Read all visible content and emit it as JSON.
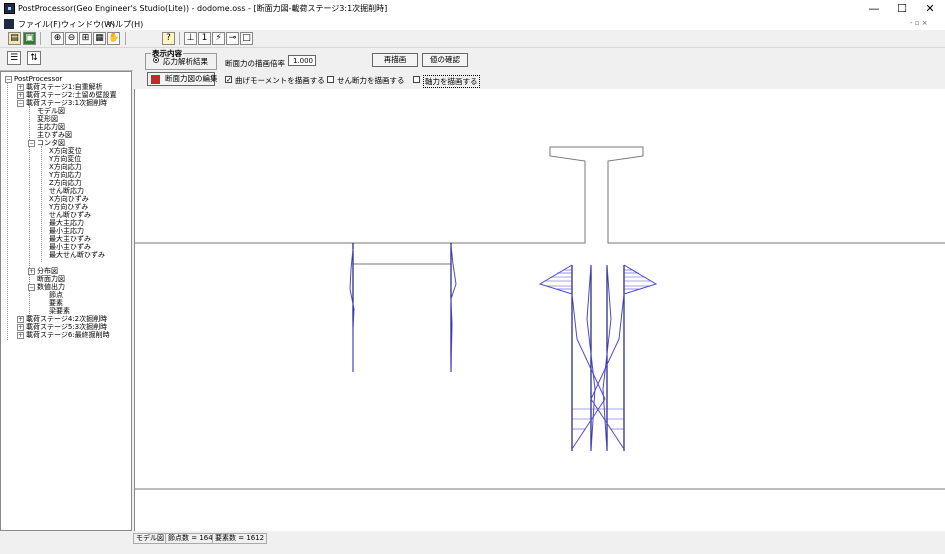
{
  "window": {
    "title": "PostProcessor(Geo Engineer's Studio(Lite)) - dodome.oss - [断面力図-載荷ステージ3:1次掘削時]",
    "minimize": "—",
    "maximize": "☐",
    "close": "✕"
  },
  "menu": {
    "items": [
      "ファイル(F)",
      "ウィンドウ(W)",
      "ヘルプ(H)"
    ],
    "mdi_controls": "- ▫ ×"
  },
  "left_tools": [
    "☰",
    "⇅"
  ],
  "tree": {
    "root": "PostProcessor",
    "nodes": [
      "載荷ステージ1:自重解析",
      "載荷ステージ2:土留め壁設置",
      "載荷ステージ3:1次掘削時",
      "モデル図",
      "変形図",
      "主応力図",
      "主ひずみ図",
      "コンタ図",
      "X方向変位",
      "Y方向変位",
      "X方向応力",
      "Y方向応力",
      "Z方向応力",
      "せん断応力",
      "X方向ひずみ",
      "Y方向ひずみ",
      "せん断ひずみ",
      "最大主応力",
      "最小主応力",
      "最大主ひずみ",
      "最小主ひずみ",
      "最大せん断ひずみ",
      "分布図",
      "断面力図",
      "数値出力",
      "節点",
      "要素",
      "梁要素",
      "載荷ステージ4:2次掘削時",
      "載荷ステージ5:3次掘削時",
      "載荷ステージ6:最終掘削時"
    ]
  },
  "controls": {
    "group_title": "表示内容",
    "radio_label": "応力解析結果",
    "scale_label": "断面力の描画倍率",
    "scale_value": "1.000",
    "redraw_button": "再描画",
    "check_values_button": "値の確認",
    "edit_button": "断面力図の編集",
    "moment_check": "曲げモーメントを描画する",
    "shear_check": "せん断力を描画する",
    "axial_check": "軸力を描画する"
  },
  "status": {
    "mode": "モデル図",
    "nodes": "節点数 = 1643",
    "elements": "要素数 = 1612"
  },
  "colors": {
    "beam": "#1a1a80",
    "diagram": "#4a4ad0",
    "outline": "#777777"
  }
}
